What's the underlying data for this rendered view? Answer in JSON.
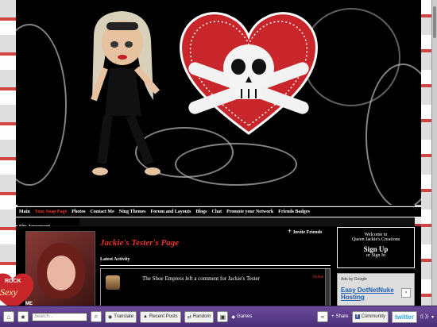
{
  "nav": {
    "items": [
      "Main",
      "Your Soap Page",
      "Photos",
      "Contact Me",
      "Ning Themes",
      "Forum and Layouts",
      "Blogs",
      "Chat",
      "Promote your Network",
      "Friends Badges"
    ],
    "active_index": 1,
    "second_row": "Site Agreement"
  },
  "profile": {
    "title": "Jackie's Tester's Page",
    "invite": "Invite Friends",
    "latest_activity": "Latest Activity",
    "activity_text": "The Shoe Empress left a comment for Jackie's Tester",
    "activity_time": "Online"
  },
  "sidebar_badge": {
    "line1": "ROCK",
    "line2": "Sexy",
    "line3": "ME"
  },
  "welcome": {
    "line1": "Welcome to",
    "line2": "Queen Jackie's Creations",
    "signup": "Sign Up",
    "signin": "or Sign In"
  },
  "ad": {
    "ads_by": "Ads by Google",
    "google": "Google",
    "link": "Easy DotNetNuke Hosting",
    "sub": "Simple steps - Lots of"
  },
  "toolbar": {
    "search_placeholder": "Search...",
    "translate": "Translate",
    "recent_posts": "Recent Posts",
    "random": "Random",
    "games": "Games",
    "share": "Share",
    "community": "Community",
    "twitter": "twitter"
  },
  "colors": {
    "accent": "#e8352f",
    "toolbar": "#5a3b88"
  }
}
